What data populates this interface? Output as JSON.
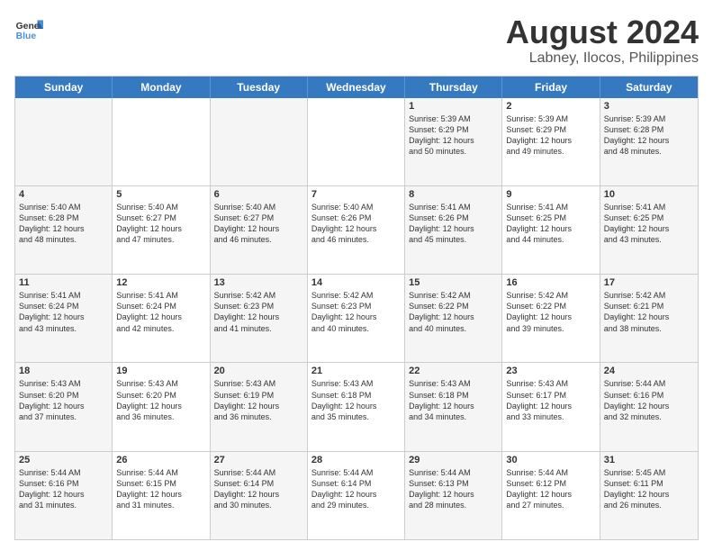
{
  "logo": {
    "line1": "General",
    "line2": "Blue"
  },
  "title": "August 2024",
  "subtitle": "Labney, Ilocos, Philippines",
  "header_days": [
    "Sunday",
    "Monday",
    "Tuesday",
    "Wednesday",
    "Thursday",
    "Friday",
    "Saturday"
  ],
  "rows": [
    [
      {
        "day": "",
        "text": ""
      },
      {
        "day": "",
        "text": ""
      },
      {
        "day": "",
        "text": ""
      },
      {
        "day": "",
        "text": ""
      },
      {
        "day": "1",
        "text": "Sunrise: 5:39 AM\nSunset: 6:29 PM\nDaylight: 12 hours\nand 50 minutes."
      },
      {
        "day": "2",
        "text": "Sunrise: 5:39 AM\nSunset: 6:29 PM\nDaylight: 12 hours\nand 49 minutes."
      },
      {
        "day": "3",
        "text": "Sunrise: 5:39 AM\nSunset: 6:28 PM\nDaylight: 12 hours\nand 48 minutes."
      }
    ],
    [
      {
        "day": "4",
        "text": "Sunrise: 5:40 AM\nSunset: 6:28 PM\nDaylight: 12 hours\nand 48 minutes."
      },
      {
        "day": "5",
        "text": "Sunrise: 5:40 AM\nSunset: 6:27 PM\nDaylight: 12 hours\nand 47 minutes."
      },
      {
        "day": "6",
        "text": "Sunrise: 5:40 AM\nSunset: 6:27 PM\nDaylight: 12 hours\nand 46 minutes."
      },
      {
        "day": "7",
        "text": "Sunrise: 5:40 AM\nSunset: 6:26 PM\nDaylight: 12 hours\nand 46 minutes."
      },
      {
        "day": "8",
        "text": "Sunrise: 5:41 AM\nSunset: 6:26 PM\nDaylight: 12 hours\nand 45 minutes."
      },
      {
        "day": "9",
        "text": "Sunrise: 5:41 AM\nSunset: 6:25 PM\nDaylight: 12 hours\nand 44 minutes."
      },
      {
        "day": "10",
        "text": "Sunrise: 5:41 AM\nSunset: 6:25 PM\nDaylight: 12 hours\nand 43 minutes."
      }
    ],
    [
      {
        "day": "11",
        "text": "Sunrise: 5:41 AM\nSunset: 6:24 PM\nDaylight: 12 hours\nand 43 minutes."
      },
      {
        "day": "12",
        "text": "Sunrise: 5:41 AM\nSunset: 6:24 PM\nDaylight: 12 hours\nand 42 minutes."
      },
      {
        "day": "13",
        "text": "Sunrise: 5:42 AM\nSunset: 6:23 PM\nDaylight: 12 hours\nand 41 minutes."
      },
      {
        "day": "14",
        "text": "Sunrise: 5:42 AM\nSunset: 6:23 PM\nDaylight: 12 hours\nand 40 minutes."
      },
      {
        "day": "15",
        "text": "Sunrise: 5:42 AM\nSunset: 6:22 PM\nDaylight: 12 hours\nand 40 minutes."
      },
      {
        "day": "16",
        "text": "Sunrise: 5:42 AM\nSunset: 6:22 PM\nDaylight: 12 hours\nand 39 minutes."
      },
      {
        "day": "17",
        "text": "Sunrise: 5:42 AM\nSunset: 6:21 PM\nDaylight: 12 hours\nand 38 minutes."
      }
    ],
    [
      {
        "day": "18",
        "text": "Sunrise: 5:43 AM\nSunset: 6:20 PM\nDaylight: 12 hours\nand 37 minutes."
      },
      {
        "day": "19",
        "text": "Sunrise: 5:43 AM\nSunset: 6:20 PM\nDaylight: 12 hours\nand 36 minutes."
      },
      {
        "day": "20",
        "text": "Sunrise: 5:43 AM\nSunset: 6:19 PM\nDaylight: 12 hours\nand 36 minutes."
      },
      {
        "day": "21",
        "text": "Sunrise: 5:43 AM\nSunset: 6:18 PM\nDaylight: 12 hours\nand 35 minutes."
      },
      {
        "day": "22",
        "text": "Sunrise: 5:43 AM\nSunset: 6:18 PM\nDaylight: 12 hours\nand 34 minutes."
      },
      {
        "day": "23",
        "text": "Sunrise: 5:43 AM\nSunset: 6:17 PM\nDaylight: 12 hours\nand 33 minutes."
      },
      {
        "day": "24",
        "text": "Sunrise: 5:44 AM\nSunset: 6:16 PM\nDaylight: 12 hours\nand 32 minutes."
      }
    ],
    [
      {
        "day": "25",
        "text": "Sunrise: 5:44 AM\nSunset: 6:16 PM\nDaylight: 12 hours\nand 31 minutes."
      },
      {
        "day": "26",
        "text": "Sunrise: 5:44 AM\nSunset: 6:15 PM\nDaylight: 12 hours\nand 31 minutes."
      },
      {
        "day": "27",
        "text": "Sunrise: 5:44 AM\nSunset: 6:14 PM\nDaylight: 12 hours\nand 30 minutes."
      },
      {
        "day": "28",
        "text": "Sunrise: 5:44 AM\nSunset: 6:14 PM\nDaylight: 12 hours\nand 29 minutes."
      },
      {
        "day": "29",
        "text": "Sunrise: 5:44 AM\nSunset: 6:13 PM\nDaylight: 12 hours\nand 28 minutes."
      },
      {
        "day": "30",
        "text": "Sunrise: 5:44 AM\nSunset: 6:12 PM\nDaylight: 12 hours\nand 27 minutes."
      },
      {
        "day": "31",
        "text": "Sunrise: 5:45 AM\nSunset: 6:11 PM\nDaylight: 12 hours\nand 26 minutes."
      }
    ]
  ]
}
